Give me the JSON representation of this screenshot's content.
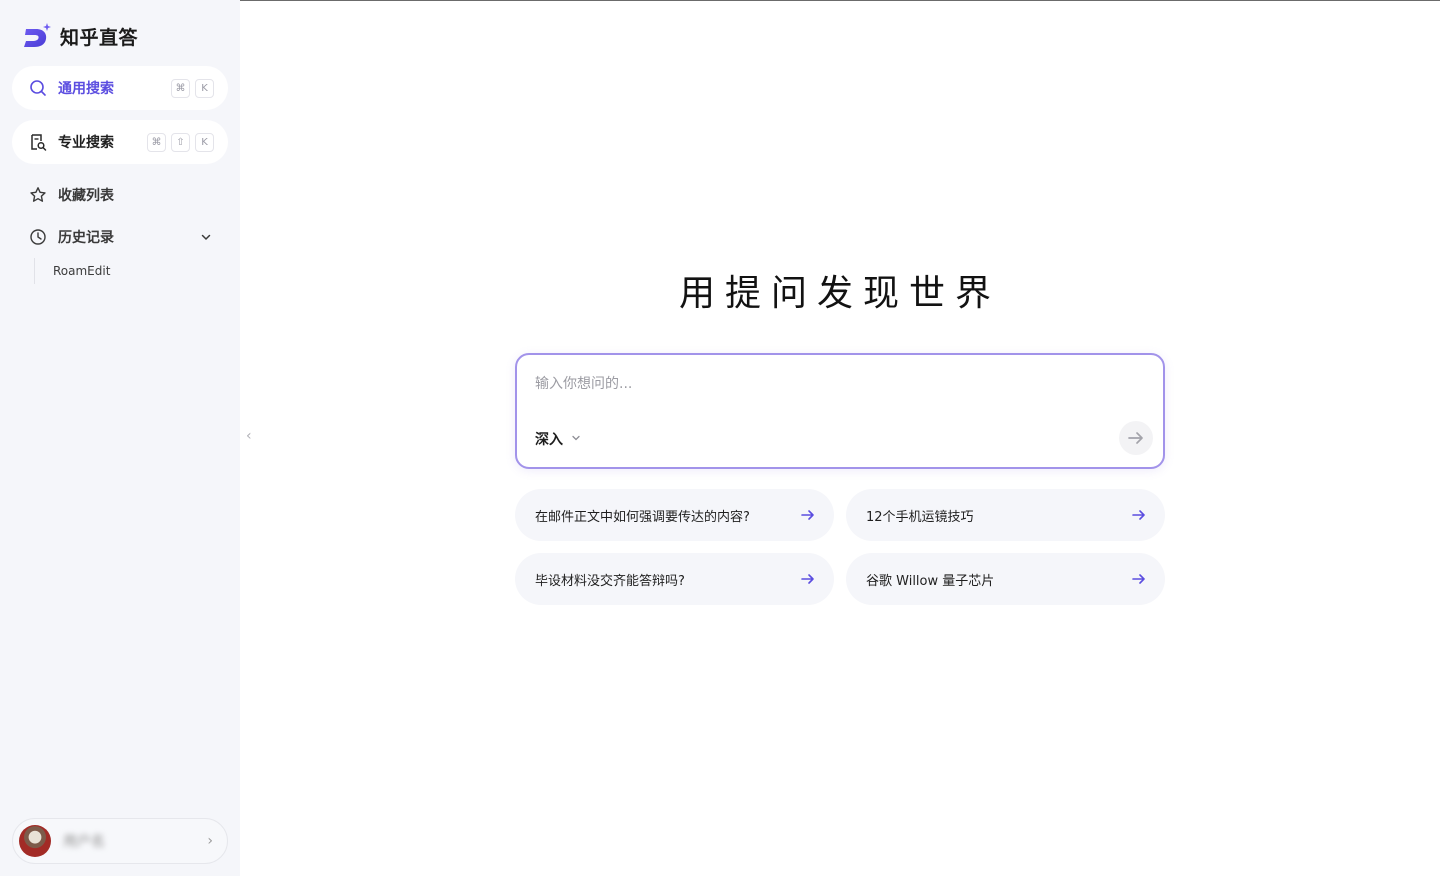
{
  "brand": {
    "name": "知乎直答"
  },
  "nav": {
    "general_search": {
      "label": "通用搜索",
      "shortcut": [
        "⌘",
        "K"
      ]
    },
    "pro_search": {
      "label": "专业搜索",
      "shortcut": [
        "⌘",
        "⇧",
        "K"
      ]
    },
    "favorites": {
      "label": "收藏列表"
    },
    "history": {
      "label": "历史记录",
      "items": [
        {
          "title": "RoamEdit"
        }
      ]
    }
  },
  "user": {
    "name": "用户名"
  },
  "main": {
    "title": "用提问发现世界",
    "ask": {
      "placeholder": "输入你想问的...",
      "mode": "深入"
    },
    "suggestions": [
      {
        "text": "在邮件正文中如何强调要传达的内容?"
      },
      {
        "text": "12个手机运镜技巧"
      },
      {
        "text": "毕设材料没交齐能答辩吗?"
      },
      {
        "text": "谷歌 Willow 量子芯片"
      }
    ]
  },
  "colors": {
    "accent": "#5b4de0",
    "sidebar_bg": "#f5f6fa",
    "input_border": "#a293ea"
  }
}
